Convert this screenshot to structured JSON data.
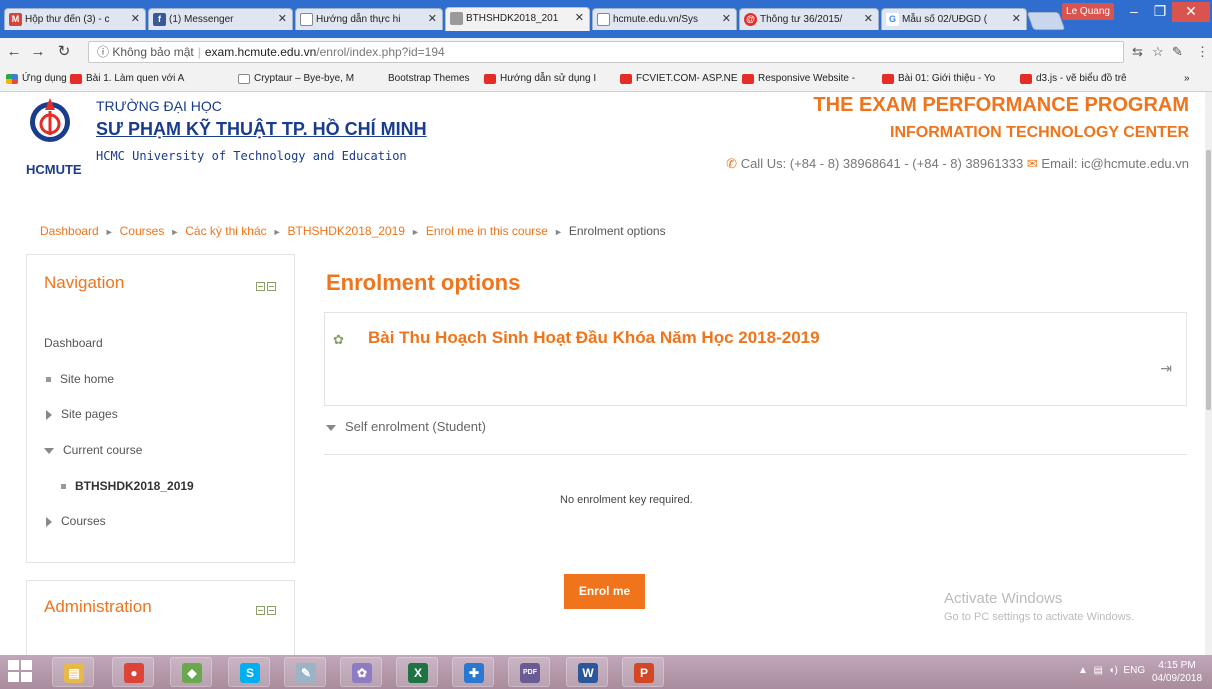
{
  "browser": {
    "tabs": [
      {
        "label": "Hộp thư đến (3) - c",
        "icon": "gmail-icon",
        "color": "#d44638",
        "glyph": "M"
      },
      {
        "label": "(1) Messenger",
        "icon": "facebook-icon",
        "color": "#3b5998",
        "glyph": "f"
      },
      {
        "label": "Hướng dẫn thực hi",
        "icon": "page-icon",
        "color": "#888888",
        "glyph": ""
      },
      {
        "label": "BTHSHDK2018_201",
        "icon": "moodle-icon",
        "color": "#888888",
        "glyph": ""
      },
      {
        "label": "hcmute.edu.vn/Sys",
        "icon": "page-icon",
        "color": "#888888",
        "glyph": ""
      },
      {
        "label": "Thông tư 36/2015/",
        "icon": "site-icon",
        "color": "#e52d27",
        "glyph": "@"
      },
      {
        "label": "Mẫu số 02/UĐGD (",
        "icon": "google-icon",
        "color": "#4285f4",
        "glyph": "G"
      }
    ],
    "user_name": "Le Quang",
    "address": {
      "security": "ⓘ Không bảo mật",
      "host": "exam.hcmute.edu.vn",
      "path": "/enrol/index.php?id=194"
    },
    "bookmarks": [
      {
        "label": "Ứng dụng",
        "type": "apps"
      },
      {
        "label": "Bài 1. Làm quen với A",
        "type": "yt"
      },
      {
        "label": "Cryptaur – Bye-bye, M",
        "type": "pg"
      },
      {
        "label": "Bootstrap Themes",
        "type": "none"
      },
      {
        "label": "Hướng dẫn sử dụng I",
        "type": "yt"
      },
      {
        "label": "FCVIET.COM- ASP.NE",
        "type": "yt"
      },
      {
        "label": "Responsive Website -",
        "type": "yt"
      },
      {
        "label": "Bài 01: Giới thiệu - Yo",
        "type": "yt"
      },
      {
        "label": "d3.js - vẽ biểu đồ trê",
        "type": "yt"
      }
    ],
    "bookmarks_more": "»"
  },
  "header": {
    "logo_text": "HCMUTE",
    "uni_line1": "TRƯỜNG ĐẠI HỌC",
    "uni_line2": "SƯ PHẠM KỸ THUẬT TP. HỒ CHÍ MINH",
    "uni_line3": "HCMC University of Technology and Education",
    "program": "THE EXAM PERFORMANCE PROGRAM",
    "center": "INFORMATION TECHNOLOGY CENTER",
    "phone": "Call Us: (+84 - 8) 38968641 - (+84 - 8) 38961333",
    "email": "Email: ic@hcmute.edu.vn"
  },
  "breadcrumb": {
    "items": [
      "Dashboard",
      "Courses",
      "Các kỳ thi khác",
      "BTHSHDK2018_2019",
      "Enrol me in this course"
    ],
    "current": "Enrolment options",
    "separator": "►"
  },
  "navigation": {
    "title": "Navigation",
    "dashboard": "Dashboard",
    "site_home": "Site home",
    "site_pages": "Site pages",
    "current_course": "Current course",
    "course_code": "BTHSHDK2018_2019",
    "courses": "Courses"
  },
  "administration": {
    "title": "Administration"
  },
  "main": {
    "title": "Enrolment options",
    "course_name": "Bài Thu Hoạch Sinh Hoạt Đầu Khóa Năm Học 2018-2019",
    "self_enrolment": "Self enrolment (Student)",
    "no_key": "No enrolment key required.",
    "enrol_button": "Enrol me"
  },
  "watermark": {
    "line1": "Activate Windows",
    "line2": "Go to PC settings to activate Windows."
  },
  "taskbar": {
    "apps": [
      {
        "name": "file-explorer-icon",
        "color": "#e8b84a",
        "glyph": "▤"
      },
      {
        "name": "chrome-icon",
        "color": "#db4437",
        "glyph": "●"
      },
      {
        "name": "folder-icon",
        "color": "#6aa84f",
        "glyph": "◆"
      },
      {
        "name": "skype-icon",
        "color": "#00aff0",
        "glyph": "S"
      },
      {
        "name": "paint-icon",
        "color": "#9bb3c7",
        "glyph": "✎"
      },
      {
        "name": "settings-app-icon",
        "color": "#8e7cc3",
        "glyph": "✿"
      },
      {
        "name": "excel-icon",
        "color": "#1f7244",
        "glyph": "X"
      },
      {
        "name": "defender-icon",
        "color": "#2b78d0",
        "glyph": "✚"
      },
      {
        "name": "pdf-icon",
        "color": "#6b5b95",
        "glyph": "PDF"
      },
      {
        "name": "word-icon",
        "color": "#2b579a",
        "glyph": "W"
      },
      {
        "name": "powerpoint-icon",
        "color": "#d24726",
        "glyph": "P"
      }
    ],
    "lang": "ENG",
    "time": "4:15 PM",
    "date": "04/09/2018"
  },
  "colors": {
    "accent": "#f0741b",
    "brand_blue": "#1a3c8c"
  }
}
